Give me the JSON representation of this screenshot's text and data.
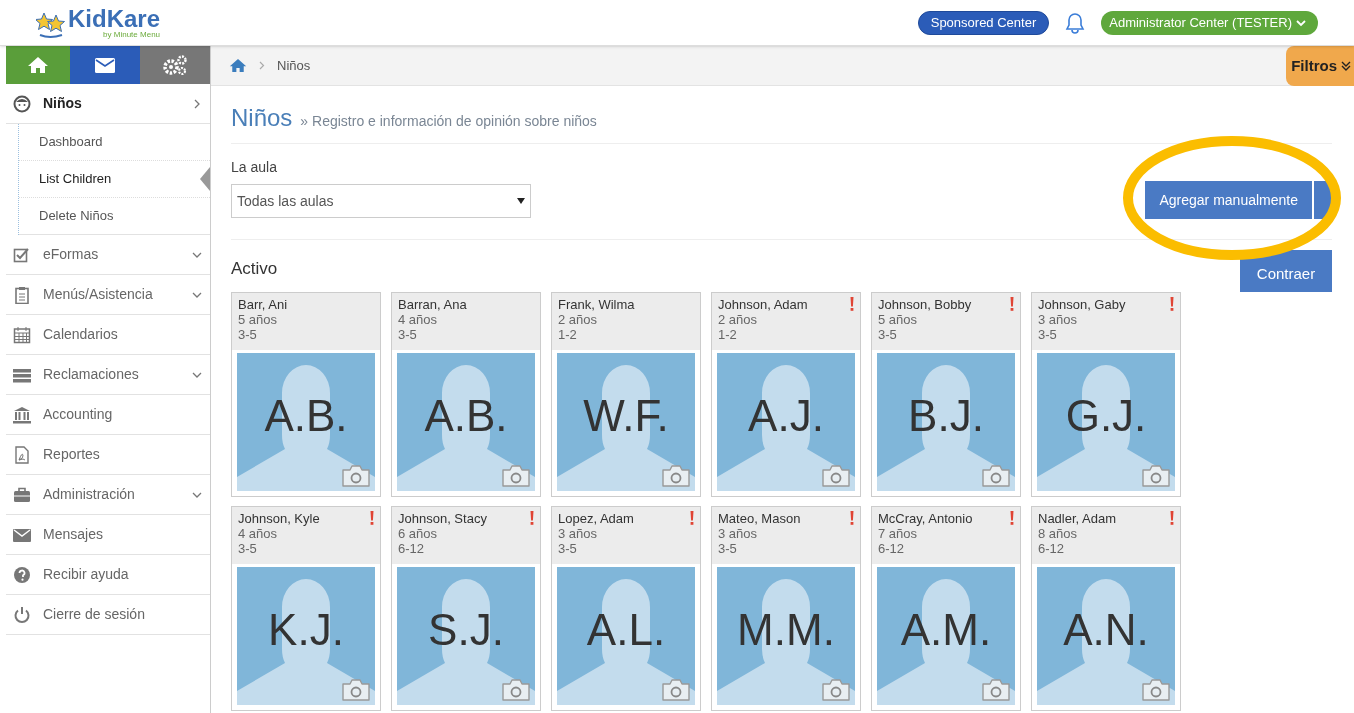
{
  "header": {
    "logo": "KidKare",
    "logo_tagline": "by Minute Menu",
    "center_button": "Sponsored Center",
    "user_menu": "Administrator Center (TESTER)"
  },
  "breadcrumb": {
    "items": [
      "Niños"
    ],
    "filter_button": "Filtros"
  },
  "sidebar": {
    "items": [
      {
        "label": "Niños",
        "expanded": true,
        "children": [
          {
            "label": "Dashboard",
            "selected": false
          },
          {
            "label": "List Children",
            "selected": true
          },
          {
            "label": "Delete Niños",
            "selected": false
          }
        ]
      },
      {
        "label": "eFormas",
        "expanded": false,
        "has_submenu": true
      },
      {
        "label": "Menús/Asistencia",
        "expanded": false,
        "has_submenu": true
      },
      {
        "label": "Calendarios",
        "expanded": false,
        "has_submenu": false
      },
      {
        "label": "Reclamaciones",
        "expanded": false,
        "has_submenu": true
      },
      {
        "label": "Accounting",
        "expanded": false,
        "has_submenu": false
      },
      {
        "label": "Reportes",
        "expanded": false,
        "has_submenu": false
      },
      {
        "label": "Administración",
        "expanded": false,
        "has_submenu": true
      },
      {
        "label": "Mensajes",
        "expanded": false,
        "has_submenu": false
      },
      {
        "label": "Recibir ayuda",
        "expanded": false,
        "has_submenu": false
      },
      {
        "label": "Cierre de sesión",
        "expanded": false,
        "has_submenu": false
      }
    ]
  },
  "page": {
    "title": "Niños",
    "subtitle": "» Registro e información de opinión sobre niños",
    "classroom_label": "La aula",
    "classroom_select": "Todas las aulas",
    "add_button": "Agregar manualmente",
    "section_title": "Activo",
    "collapse_button": "Contraer"
  },
  "children": [
    {
      "name": "Barr, Ani",
      "age": "5 años",
      "group": "3-5",
      "initials": "A.B.",
      "alert": false
    },
    {
      "name": "Barran, Ana",
      "age": "4 años",
      "group": "3-5",
      "initials": "A.B.",
      "alert": false
    },
    {
      "name": "Frank, Wilma",
      "age": "2 años",
      "group": "1-2",
      "initials": "W.F.",
      "alert": false
    },
    {
      "name": "Johnson, Adam",
      "age": "2 años",
      "group": "1-2",
      "initials": "A.J.",
      "alert": true
    },
    {
      "name": "Johnson, Bobby",
      "age": "5 años",
      "group": "3-5",
      "initials": "B.J.",
      "alert": true
    },
    {
      "name": "Johnson, Gaby",
      "age": "3 años",
      "group": "3-5",
      "initials": "G.J.",
      "alert": true
    },
    {
      "name": "Johnson, Kyle",
      "age": "4 años",
      "group": "3-5",
      "initials": "K.J.",
      "alert": true
    },
    {
      "name": "Johnson, Stacy",
      "age": "6 años",
      "group": "6-12",
      "initials": "S.J.",
      "alert": true
    },
    {
      "name": "Lopez, Adam",
      "age": "3 años",
      "group": "3-5",
      "initials": "A.L.",
      "alert": true
    },
    {
      "name": "Mateo, Mason",
      "age": "3 años",
      "group": "3-5",
      "initials": "M.M.",
      "alert": true
    },
    {
      "name": "McCray, Antonio",
      "age": "7 años",
      "group": "6-12",
      "initials": "A.M.",
      "alert": true
    },
    {
      "name": "Nadler, Adam",
      "age": "8 años",
      "group": "6-12",
      "initials": "A.N.",
      "alert": true
    }
  ]
}
